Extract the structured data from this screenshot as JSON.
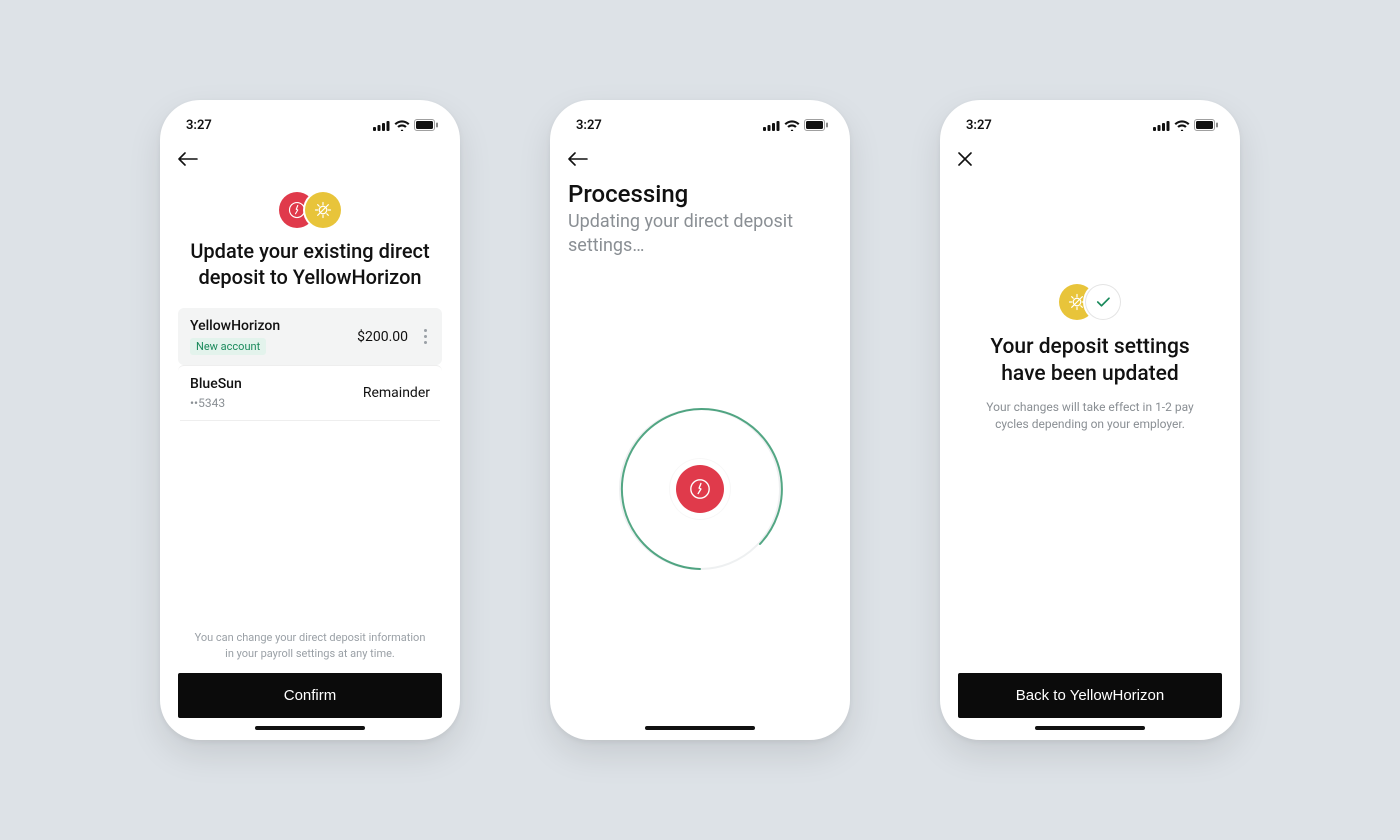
{
  "status": {
    "time": "3:27"
  },
  "screen1": {
    "headline": "Update your existing direct deposit to YellowHorizon",
    "accounts": [
      {
        "name": "YellowHorizon",
        "badge": "New account",
        "amount": "$200.00"
      },
      {
        "name": "BlueSun",
        "sub": "••5343",
        "amount": "Remainder"
      }
    ],
    "helper": "You can change your direct deposit information in your payroll settings at any time.",
    "cta": "Confirm"
  },
  "screen2": {
    "title": "Processing",
    "subtitle": "Updating your direct deposit settings…"
  },
  "screen3": {
    "headline": "Your deposit settings have been updated",
    "sub": "Your changes will take effect in 1-2 pay cycles depending on your employer.",
    "cta": "Back to YellowHorizon"
  },
  "colors": {
    "red": "#e03a4b",
    "yellow": "#e8c43a",
    "green": "#1a8a5b"
  }
}
